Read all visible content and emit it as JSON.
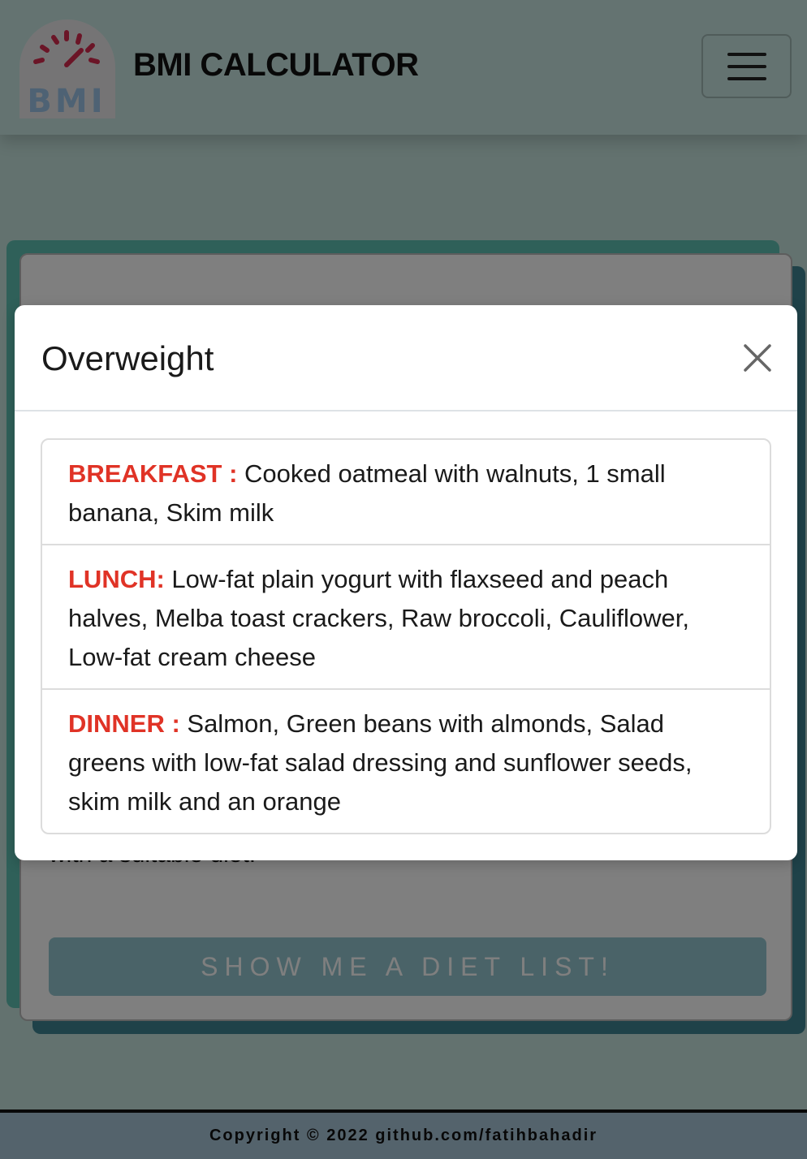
{
  "navbar": {
    "logo_text": "BMI",
    "brand": "BMI CALCULATOR",
    "menu_icon": "hamburger-icon"
  },
  "card": {
    "text": "with a suitable diet.",
    "button_label": "SHOW ME A DIET LIST!"
  },
  "footer": {
    "copyright": "Copyright © 2022 github.com/fatihbahadir"
  },
  "modal": {
    "title": "Overweight",
    "close_icon": "close-icon",
    "items": [
      {
        "label": "BREAKFAST :",
        "text": " Cooked oatmeal with walnuts, 1 small banana, Skim milk"
      },
      {
        "label": "LUNCH:",
        "text": " Low-fat plain yogurt with flaxseed and peach halves, Melba toast crackers, Raw broccoli, Cauliflower, Low-fat cream cheese"
      },
      {
        "label": "DINNER :",
        "text": " Salmon, Green beans with almonds, Salad greens with low-fat salad dressing and sunflower seeds, skim milk and an orange"
      }
    ]
  },
  "colors": {
    "accent_red": "#e03326",
    "navbar_bg": "#c9e7e3",
    "card_teal": "#5fc1b3",
    "card_dark": "#3e8592",
    "button_bg": "#95c7d0",
    "footer_bg": "#a9c6d9"
  }
}
